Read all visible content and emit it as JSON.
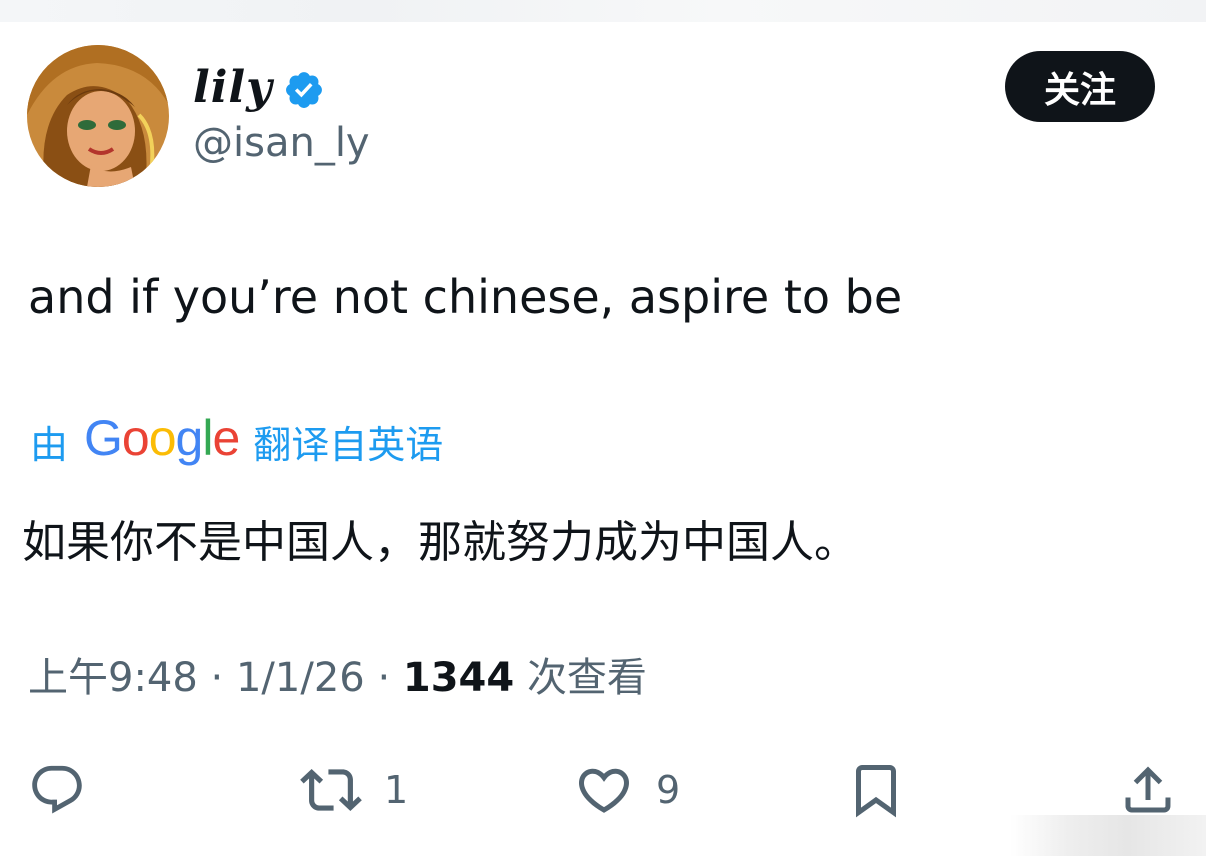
{
  "user": {
    "display_name": "lily",
    "handle": "@isan_ly",
    "avatar_icon": "avatar-cartoon-portrait",
    "verified_icon": "verified-badge-icon"
  },
  "follow_button": {
    "label": "关注"
  },
  "tweet": {
    "text": "and if you’re not chinese, aspire to be"
  },
  "translation": {
    "prefix": "由",
    "provider": "Google",
    "suffix": "翻译自英语",
    "text": "如果你不是中国人，那就努力成为中国人。"
  },
  "meta": {
    "time": "上午9:48",
    "separator": "·",
    "date": "1/1/26",
    "views_count": "1344",
    "views_label": "次查看"
  },
  "actions": {
    "reply": {
      "icon": "reply-icon"
    },
    "retweet": {
      "icon": "retweet-icon",
      "count": "1"
    },
    "like": {
      "icon": "heart-icon",
      "count": "9"
    },
    "bookmark": {
      "icon": "bookmark-icon"
    },
    "share": {
      "icon": "share-icon"
    }
  },
  "colors": {
    "accent": "#1d9bf0",
    "text_primary": "#0f1419",
    "text_secondary": "#536471",
    "button_bg": "#0f1419"
  }
}
